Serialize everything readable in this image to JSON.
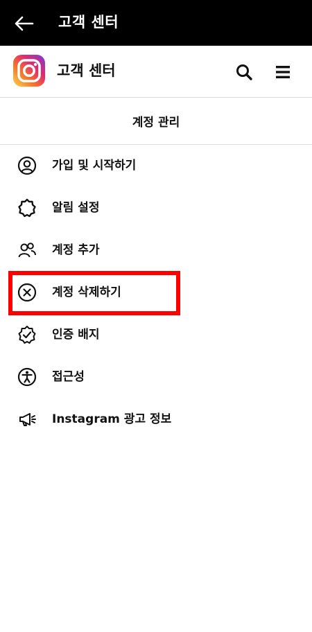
{
  "topbar": {
    "title": "고객 센터"
  },
  "hc_header": {
    "title": "고객 센터"
  },
  "section": {
    "title": "계정 관리"
  },
  "menu": [
    {
      "label": "가입 및 시작하기",
      "icon": "user-circle-icon"
    },
    {
      "label": "알림 설정",
      "icon": "bell-badge-icon"
    },
    {
      "label": "계정 추가",
      "icon": "add-people-icon"
    },
    {
      "label": "계정 삭제하기",
      "icon": "circle-x-icon"
    },
    {
      "label": "인증 배지",
      "icon": "verified-badge-icon"
    },
    {
      "label": "접근성",
      "icon": "accessibility-icon"
    },
    {
      "label": "Instagram 광고 정보",
      "icon": "megaphone-icon"
    }
  ],
  "colors": {
    "highlight": "#ff0000",
    "topbar": "#000000"
  }
}
